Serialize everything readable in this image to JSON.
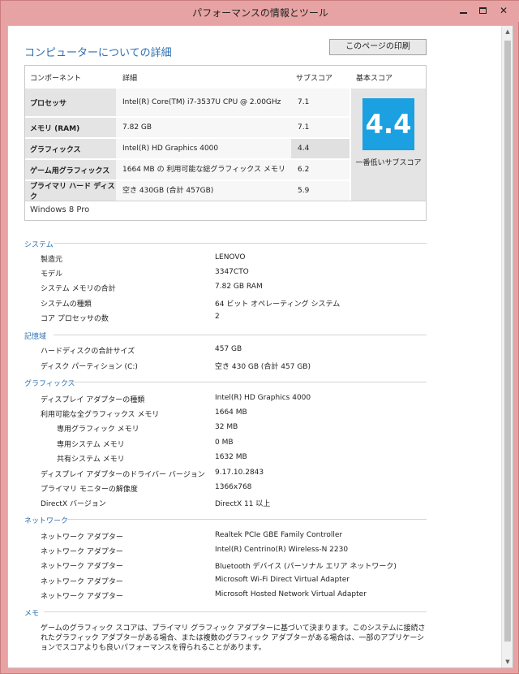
{
  "window": {
    "title": "パフォーマンスの情報とツール"
  },
  "page": {
    "heading": "コンピューターについての詳細",
    "print_button": "このページの印刷"
  },
  "score_table": {
    "headers": {
      "component": "コンポーネント",
      "detail": "詳細",
      "subscore": "サブスコア",
      "base": "基本スコア"
    },
    "rows": [
      {
        "name": "プロセッサ",
        "detail": "Intel(R) Core(TM) i7-3537U CPU @ 2.00GHz",
        "subscore": "7.1"
      },
      {
        "name": "メモリ (RAM)",
        "detail": "7.82 GB",
        "subscore": "7.1"
      },
      {
        "name": "グラフィックス",
        "detail": "Intel(R) HD Graphics 4000",
        "subscore": "4.4"
      },
      {
        "name": "ゲーム用グラフィックス",
        "detail": "1664 MB の 利用可能な総グラフィックス メモリ",
        "subscore": "6.2"
      },
      {
        "name": "プライマリ ハード ディスク",
        "detail": "空き 430GB (合計 457GB)",
        "subscore": "5.9"
      }
    ],
    "base_score": "4.4",
    "base_caption": "一番低いサブスコア",
    "os": "Windows 8 Pro",
    "tile_color": "#1ba0e1"
  },
  "system": {
    "title": "システム",
    "items": [
      {
        "key": "製造元",
        "value": "LENOVO"
      },
      {
        "key": "モデル",
        "value": "3347CTO"
      },
      {
        "key": "システム メモリの合計",
        "value": "7.82 GB RAM"
      },
      {
        "key": "システムの種類",
        "value": "64 ビット オペレーティング システム"
      },
      {
        "key": "コア プロセッサの数",
        "value": "2"
      }
    ]
  },
  "storage": {
    "title": "記憶域",
    "items": [
      {
        "key": "ハードディスクの合計サイズ",
        "value": "457 GB"
      },
      {
        "key": "ディスク パーティション (C:)",
        "value": "空き 430 GB (合計 457 GB)"
      }
    ]
  },
  "graphics": {
    "title": "グラフィックス",
    "items": [
      {
        "key": "ディスプレイ アダプターの種類",
        "value": "Intel(R) HD Graphics 4000"
      },
      {
        "key": "利用可能な全グラフィックス メモリ",
        "value": "1664 MB"
      },
      {
        "key": "専用グラフィック メモリ",
        "value": "32 MB"
      },
      {
        "key": "専用システム メモリ",
        "value": "0 MB"
      },
      {
        "key": "共有システム メモリ",
        "value": "1632 MB"
      },
      {
        "key": "ディスプレイ アダプターのドライバー バージョン",
        "value": "9.17.10.2843"
      },
      {
        "key": "プライマリ モニターの解像度",
        "value": "1366x768"
      },
      {
        "key": "DirectX バージョン",
        "value": "DirectX 11 以上"
      }
    ]
  },
  "network": {
    "title": "ネットワーク",
    "items": [
      {
        "key": "ネットワーク アダプター",
        "value": "Realtek PCIe GBE Family Controller"
      },
      {
        "key": "ネットワーク アダプター",
        "value": "Intel(R) Centrino(R) Wireless-N 2230"
      },
      {
        "key": "ネットワーク アダプター",
        "value": "Bluetooth デバイス (パーソナル エリア ネットワーク)"
      },
      {
        "key": "ネットワーク アダプター",
        "value": "Microsoft Wi-Fi Direct Virtual Adapter"
      },
      {
        "key": "ネットワーク アダプター",
        "value": "Microsoft Hosted Network Virtual Adapter"
      }
    ]
  },
  "memo": {
    "title": "メモ",
    "text": "ゲームのグラフィック スコアは、プライマリ グラフィック アダプターに基づいて決まります。このシステムに接続されたグラフィック アダプターがある場合、または複数のグラフィック アダプターがある場合は、一部のアプリケーションでスコアよりも良いパフォーマンスを得られることがあります。"
  }
}
